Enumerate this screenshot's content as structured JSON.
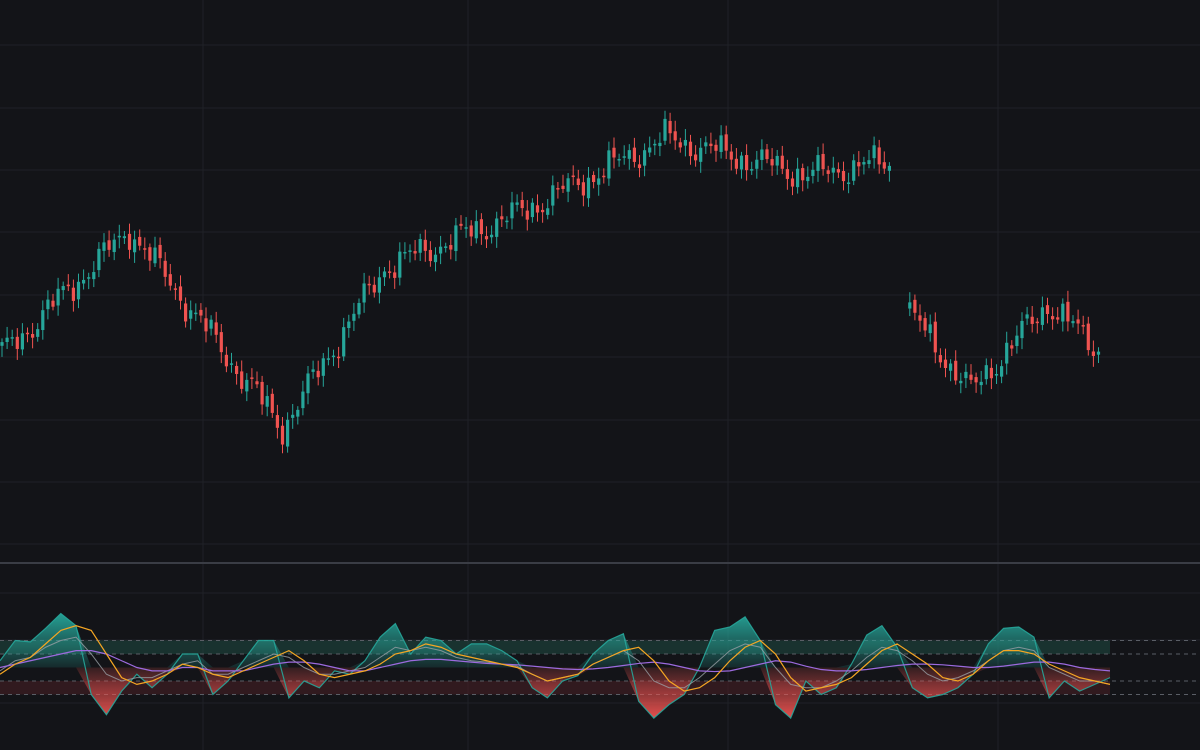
{
  "theme": {
    "background": "#131418",
    "grid": "#1f2127",
    "separator": "#3a3d45",
    "up": "#26a69a",
    "down": "#ef5350",
    "oscillator_fast": "#f5a623",
    "oscillator_slow": "#9c6ade",
    "oscillator_signal": "#9aa0a6",
    "overbought_zone": "#1f4a44",
    "oversold_zone": "#4a1f26"
  },
  "chart_data": [
    {
      "type": "candlestick",
      "title": "",
      "xlabel": "",
      "ylabel": "",
      "ylim": [
        0,
        100
      ],
      "grid": true,
      "segments": [
        {
          "name": "",
          "start": 0,
          "end": 174
        },
        {
          "name": "",
          "start": 178,
          "end": 215
        }
      ],
      "key_closes": [
        {
          "index": 0,
          "close": 36
        },
        {
          "index": 25,
          "close": 63
        },
        {
          "index": 55,
          "close": 20
        },
        {
          "index": 75,
          "close": 55
        },
        {
          "index": 102,
          "close": 67
        },
        {
          "index": 130,
          "close": 83
        },
        {
          "index": 158,
          "close": 75
        },
        {
          "index": 174,
          "close": 78
        },
        {
          "index": 178,
          "close": 45
        },
        {
          "index": 190,
          "close": 28
        },
        {
          "index": 205,
          "close": 47
        },
        {
          "index": 215,
          "close": 37
        }
      ]
    },
    {
      "type": "area",
      "title": "",
      "ylim": [
        -100,
        100
      ],
      "levels": [
        40,
        20,
        -20,
        -40
      ],
      "series": [
        {
          "name": "",
          "values": [
            10,
            40,
            38,
            58,
            80,
            62,
            -40,
            -70,
            -35,
            -10,
            -30,
            -10,
            20,
            20,
            -40,
            -20,
            10,
            40,
            40,
            -45,
            -20,
            -30,
            -5,
            -10,
            10,
            45,
            65,
            20,
            45,
            40,
            20,
            35,
            35,
            25,
            10,
            -30,
            -45,
            -20,
            -12,
            20,
            40,
            50,
            -50,
            -75,
            -55,
            -40,
            0,
            55,
            60,
            75,
            40,
            -55,
            -75,
            -20,
            -40,
            -30,
            5,
            48,
            62,
            30,
            -30,
            -45,
            -40,
            -30,
            -10,
            35,
            58,
            60,
            45,
            -45,
            -20,
            -35,
            -25,
            -15
          ]
        },
        {
          "name": "",
          "values": [
            -10,
            5,
            15,
            35,
            55,
            62,
            55,
            20,
            -15,
            -25,
            -20,
            -10,
            5,
            0,
            -10,
            -15,
            -5,
            5,
            15,
            25,
            10,
            -10,
            -15,
            -10,
            -5,
            5,
            20,
            25,
            35,
            30,
            20,
            15,
            10,
            5,
            0,
            -10,
            -20,
            -15,
            -10,
            5,
            15,
            25,
            30,
            10,
            -20,
            -35,
            -30,
            -15,
            10,
            30,
            40,
            20,
            -15,
            -35,
            -30,
            -25,
            -15,
            5,
            25,
            35,
            20,
            5,
            -15,
            -20,
            -10,
            10,
            25,
            25,
            20,
            5,
            -5,
            -15,
            -20,
            -25
          ]
        },
        {
          "name": "",
          "values": [
            0,
            5,
            10,
            15,
            20,
            25,
            25,
            20,
            10,
            0,
            -5,
            -5,
            0,
            0,
            -5,
            -5,
            -5,
            0,
            5,
            8,
            8,
            5,
            0,
            -5,
            -5,
            0,
            5,
            10,
            12,
            12,
            10,
            8,
            6,
            5,
            4,
            2,
            0,
            -2,
            -3,
            -2,
            0,
            3,
            6,
            8,
            5,
            0,
            -5,
            -6,
            -5,
            0,
            5,
            10,
            8,
            2,
            -3,
            -5,
            -5,
            -3,
            0,
            3,
            5,
            5,
            4,
            2,
            0,
            0,
            2,
            5,
            8,
            8,
            5,
            0,
            -3,
            -5
          ]
        },
        {
          "name": "",
          "values": [
            -5,
            10,
            15,
            30,
            40,
            45,
            20,
            -10,
            -20,
            -15,
            -15,
            -5,
            5,
            10,
            -10,
            -10,
            0,
            10,
            20,
            15,
            0,
            -10,
            -10,
            -5,
            0,
            15,
            30,
            25,
            30,
            25,
            15,
            10,
            8,
            5,
            2,
            -10,
            -20,
            -15,
            -10,
            5,
            15,
            25,
            10,
            -20,
            -30,
            -30,
            -15,
            5,
            25,
            35,
            30,
            0,
            -25,
            -30,
            -30,
            -20,
            -5,
            15,
            30,
            25,
            10,
            -10,
            -20,
            -15,
            -5,
            10,
            25,
            30,
            25,
            0,
            -10,
            -20,
            -20,
            -25
          ]
        }
      ]
    }
  ]
}
